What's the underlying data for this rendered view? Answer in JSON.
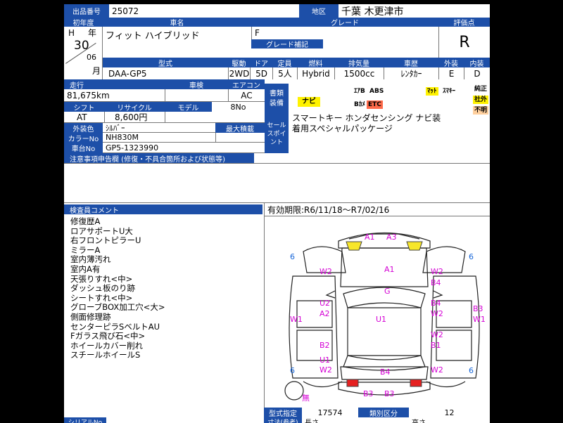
{
  "header": {
    "lot_label": "出品番号",
    "lot_no": "25072",
    "region_label": "地区",
    "region": "千葉 木更津市"
  },
  "row1": {
    "year_label": "初年度",
    "carname_label": "車名",
    "grade_label": "グレード",
    "score_label": "評価点",
    "era": "H",
    "year_unit": "年",
    "year": "30",
    "month": "06",
    "month_unit": "月",
    "car_name": "フィット ハイブリッド",
    "grade": "F",
    "grade_note_label": "グレード補記",
    "score": "R"
  },
  "spec": {
    "labels": [
      "型式",
      "駆動",
      "ドア",
      "定員",
      "燃料",
      "排気量",
      "車歴",
      "外装",
      "内装"
    ],
    "values": [
      "DAA-GP5",
      "2WD",
      "5D",
      "5人",
      "Hybrid",
      "1500cc",
      "ﾚﾝﾀｶｰ",
      "E",
      "D"
    ]
  },
  "details": {
    "mileage_label": "走行",
    "inspection_label": "車検",
    "ac_label": "エアコン",
    "mileage": "81,675km",
    "inspection": "",
    "ac": "AC",
    "shift_label": "シフト",
    "recycle_label": "リサイクル",
    "model_label": "モデル",
    "shift": "AT",
    "recycle": "8,600円",
    "model": "8No",
    "color_label": "外装色",
    "color": "ｼﾙﾊﾞｰ",
    "load_label": "最大積載",
    "color_no_label": "カラーNo",
    "color_no": "NH830M",
    "chassis_label": "車台No",
    "chassis": "GP5-1323990",
    "equip_label": "書類装備",
    "sales_label": "セールスポイント",
    "sales_text": [
      "スマートキー ホンダセンシング ナビ装",
      "着用スペシャルパッケージ"
    ]
  },
  "equipment": {
    "navi": "ナビ",
    "airbag": "ｴｱB",
    "abs": "ABS",
    "mat": "ﾏｯﾄ",
    "smart_key": "ｽﾏｷｰ",
    "back_camera": "Bｶﾒ",
    "etc": "ETC",
    "genuine": "純正",
    "aftermarket": "社外",
    "unknown": "不明",
    "highlight_yellow": "#fff200",
    "highlight_red": "#ff6a4a",
    "highlight_orange": "#ffd09e"
  },
  "notes": {
    "label": "注意事項申告欄 (修復・不具合箇所および状態等)"
  },
  "inspector": {
    "label": "検査員コメント",
    "comments": [
      "修復歴A",
      "ロアサポートU大",
      "右フロントピラーU",
      "ミラーA",
      "室内薄汚れ",
      "室内A有",
      "天張りすれ<中>",
      "ダッシュ板のり跡",
      "シートすれ<中>",
      "グローブBOX加工穴<大>",
      "側面修理跡",
      "センターピラSベルトAU",
      "Fガラス飛び石<中>",
      "ホイールカバー削れ",
      "スチールホイールS"
    ]
  },
  "validity": "有効期限:R6/11/18〜R7/02/16",
  "damage_labels": {
    "A1_top": "A1",
    "A3_top": "A3",
    "six_tl": "6",
    "six_tr": "6",
    "W2_l1": "W2",
    "A1_hood": "A1",
    "W2_r1": "W2",
    "B4_r1": "B4",
    "G": "G",
    "U2_l": "U2",
    "A2_l": "A2",
    "U1": "U1",
    "B4_r2": "B4",
    "W2_r2": "W2",
    "W1_l": "W1",
    "B3_r": "B3",
    "W1_r": "W1",
    "W2_r3": "W2",
    "B1_r": "B1",
    "B2_l": "B2",
    "U1_l": "U1",
    "six_bl": "6",
    "W2_l2": "W2",
    "B4_bot": "B4",
    "W2_r4": "W2",
    "six_br": "6",
    "B3_b1": "B3",
    "B3_b2": "B3",
    "none": "無"
  },
  "footer": {
    "type_spec_label": "型式指定",
    "type_spec": "17574",
    "class_label": "類別区分",
    "class_no": "12",
    "size_label": "寸法(参考)",
    "length_label": "長さ",
    "height_label": "高さ",
    "serial_label": "シリアルNo"
  }
}
